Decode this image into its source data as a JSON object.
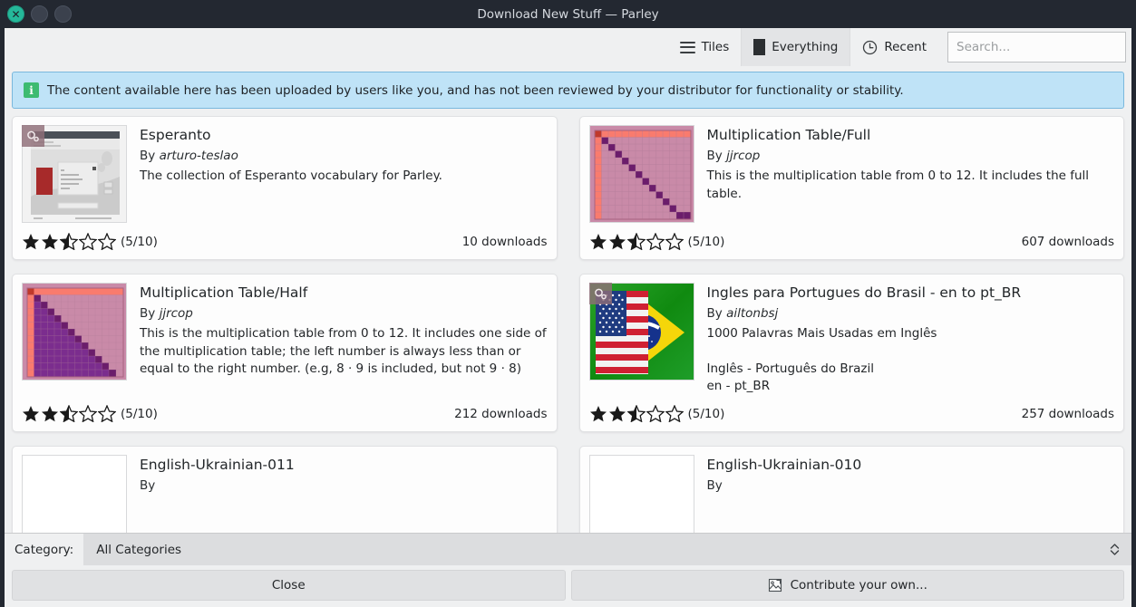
{
  "window": {
    "title": "Download New Stuff — Parley",
    "controls": {
      "close": "close-button",
      "minimize": "minimize-button",
      "maximize": "maximize-button"
    }
  },
  "toolbar": {
    "view_button": {
      "label": "Tiles",
      "icon": "hamburger-icon"
    },
    "filter_button": {
      "label": "Everything",
      "icon": "square-icon",
      "active": true
    },
    "sort_button": {
      "label": "Recent",
      "icon": "clock-icon"
    },
    "search": {
      "placeholder": "Search...",
      "value": ""
    }
  },
  "banner": {
    "icon": "info-icon",
    "text": "The content available here has been uploaded by users like you, and has not been reviewed by your distributor for functionality or stability."
  },
  "entries": [
    {
      "title": "Esperanto",
      "by_prefix": "By",
      "author": "arturo-teslao",
      "description": "The collection of Esperanto vocabulary for Parley.",
      "rating_label": "(5/10)",
      "rating_stars": 2.5,
      "downloads": "10 downloads",
      "thumbnail": "screenshot-thumbnail",
      "has_badge": true
    },
    {
      "title": "Multiplication Table/Full",
      "by_prefix": "By",
      "author": "jjrcop",
      "description": "This is the multiplication table from 0 to 12. It includes the full table.",
      "rating_label": "(5/10)",
      "rating_stars": 2.5,
      "downloads": "607 downloads",
      "thumbnail": "multiplication-full-thumbnail",
      "has_badge": false
    },
    {
      "title": "Multiplication Table/Half",
      "by_prefix": "By",
      "author": "jjrcop",
      "description": "This is the multiplication table from 0 to 12. It includes one side of the multiplication table; the left number is always less than or equal to the right number. (e.g, 8 · 9 is included, but not 9 · 8)",
      "rating_label": "(5/10)",
      "rating_stars": 2.5,
      "downloads": "212 downloads",
      "thumbnail": "multiplication-half-thumbnail",
      "has_badge": false
    },
    {
      "title": "Ingles para Portugues do Brasil - en to pt_BR",
      "by_prefix": "By",
      "author": "ailtonbsj",
      "description": "1000 Palavras Mais Usadas em Inglês\n\nInglês - Português do Brazil\nen - pt_BR",
      "rating_label": "(5/10)",
      "rating_stars": 2.5,
      "downloads": "257 downloads",
      "thumbnail": "flags-thumbnail",
      "has_badge": true
    },
    {
      "title": "English-Ukrainian-011",
      "by_prefix": "By",
      "author": "",
      "description": "",
      "rating_label": "",
      "rating_stars": 0,
      "downloads": "",
      "thumbnail": "blank-thumbnail",
      "has_badge": false
    },
    {
      "title": "English-Ukrainian-010",
      "by_prefix": "By",
      "author": "",
      "description": "",
      "rating_label": "",
      "rating_stars": 0,
      "downloads": "",
      "thumbnail": "blank-thumbnail",
      "has_badge": false
    }
  ],
  "category": {
    "label": "Category:",
    "selected": "All Categories"
  },
  "footer": {
    "close_label": "Close",
    "contribute_label": "Contribute your own...",
    "contribute_icon": "picture-icon"
  },
  "colors": {
    "accent_close": "#25b89a",
    "banner_bg": "#bfe3f7",
    "banner_border": "#7ab8dd",
    "info_icon": "#3dbb71",
    "titlebar": "#232831",
    "surface": "#eff0f1"
  }
}
